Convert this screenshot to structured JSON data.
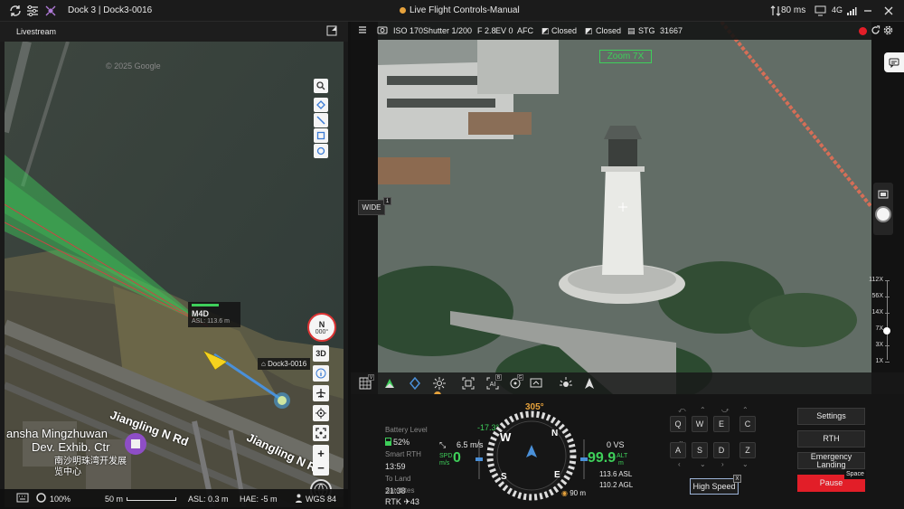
{
  "topbar": {
    "title": "Dock 3 | Dock3-0016",
    "mode_text": "Live Flight Controls-Manual",
    "latency": "80 ms",
    "signal": "4G"
  },
  "livestream": {
    "label": "Livestream"
  },
  "map": {
    "watermark": "© 2025 Google",
    "drone_name": "M4D",
    "drone_asl": "ASL: 113.6 m",
    "dock_label": "Dock3-0016",
    "place_line1": "ansha Mingzhuwan",
    "place_line2": "Dev. Exhib. Ctr",
    "place_chinese": "南沙明珠湾开发展览中心",
    "road_label_1": "Jiangling N Rd",
    "road_label_2": "Jiangling N Rd",
    "compass_letter": "N",
    "compass_heading": "000°",
    "btn_3d": "3D",
    "zoom_in": "+",
    "zoom_out": "−",
    "footer": {
      "opacity": "100%",
      "scale": "50 m",
      "asl": "ASL: 0.3 m",
      "hae": "HAE: -5 m",
      "datum": "WGS 84"
    }
  },
  "camera_info": {
    "iso": "ISO 170",
    "shutter": "Shutter 1/200",
    "fstop": "F 2.8",
    "ev": "EV 0",
    "focus": "AFC",
    "closed_1": "Closed",
    "closed_2": "Closed",
    "storage": "STG",
    "storage_value": "31667"
  },
  "camera_view": {
    "zoom_overlay": "Zoom 7X",
    "wide_label": "WIDE",
    "wide_badge": "1",
    "zoom_levels": [
      "112X",
      "56X",
      "14X",
      "7X",
      "3X",
      "1X"
    ],
    "zoom_fraction": 0.62
  },
  "toolbar_badges": {
    "grid_badge": "V",
    "ai_badge": "B",
    "lock_badge": "G"
  },
  "flight": {
    "battery_label": "Battery Level",
    "battery_value": "52%",
    "battery_fraction": 0.52,
    "smart_rth_label": "Smart RTH",
    "smart_rth_value": "13:59",
    "to_land_label": "To Land",
    "to_land_value": "21:38",
    "satellites_label": "Satellites",
    "satellites_value": "RTK",
    "satellites_count": "43",
    "heading": "305°",
    "pitch": "-17.3°",
    "speed_h": "6.5 m/s",
    "spd_label": "SPD",
    "spd_unit": "m/s",
    "spd_value": "0",
    "vs_value": "0 VS",
    "alt_value": "99.9",
    "alt_label": "ALT",
    "alt_unit": "m",
    "asl_value": "113.6 ASL",
    "agl_value": "110.2 AGL",
    "distance": "90 m",
    "compass_labels": [
      "W",
      "N",
      "S",
      "E"
    ]
  },
  "keys": {
    "row1": [
      "Q",
      "W",
      "E",
      "C"
    ],
    "row2": [
      "A",
      "S",
      "D",
      "Z"
    ],
    "high_speed": "High Speed",
    "close": "X"
  },
  "buttons": {
    "settings": "Settings",
    "rth": "RTH",
    "emergency_line1": "Emergency",
    "emergency_line2": "Landing",
    "pause": "Pause",
    "space": "Space"
  },
  "colors": {
    "accent_orange": "#e6a23c",
    "pause_red": "#e21e28",
    "drone_yellow": "#f5d21e",
    "green_ok": "#3ecf5a"
  }
}
